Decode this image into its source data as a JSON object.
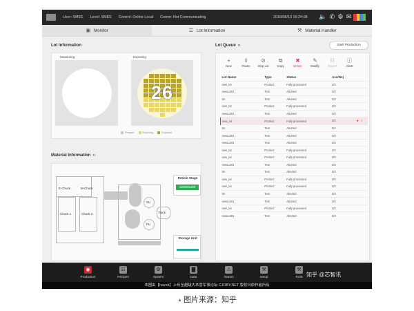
{
  "status_bar": {
    "user": "User: SMEE",
    "level": "Level: SMEE",
    "control": "Control: Online Local",
    "comm": "Comm: Not Communicating",
    "datetime": "2018/08/13 16:24:08",
    "icons": [
      "logo",
      "volume-icon",
      "phone-icon",
      "gear-icon",
      "mail-icon",
      "flag-icon"
    ]
  },
  "tabs": [
    {
      "label": "Monitor",
      "icon": "monitor-icon",
      "active": true
    },
    {
      "label": "Lot Information",
      "icon": "list-icon",
      "active": false
    },
    {
      "label": "Material Handler",
      "icon": "robot-arm-icon",
      "active": false
    }
  ],
  "lot_info": {
    "title": "Lot Information",
    "measuring_label": "Measuring",
    "exposing_label": "Exposing",
    "wafer_number": "26",
    "legend": [
      "Prepare",
      "Exposing",
      "Exposed"
    ],
    "colors": {
      "pending": "#c9c9c9",
      "exposing": "#e8d86a",
      "exposed": "#b9a52e",
      "wafer_bg": "#fbf6d8"
    }
  },
  "material_info": {
    "title": "Material Information",
    "e_chuck": "E-Chuck",
    "m_chuck": "M-Chuck",
    "chuck1": "Chuck 1",
    "chuck2": "Chuck 2",
    "reticle_stage_title": "Reticle Stage",
    "reticle_stage_value": "1105001300",
    "su_label": "SU",
    "track_label": "Track",
    "pu_label": "PU",
    "storage_unit_title": "Storage Unit"
  },
  "lot_queue": {
    "title": "Lot Queue",
    "start_button": "Start Production",
    "toolbar": [
      {
        "label": "New",
        "icon": "plus-icon",
        "state": "normal"
      },
      {
        "label": "Pause",
        "icon": "pause-icon",
        "state": "normal"
      },
      {
        "label": "Stop Lot",
        "icon": "stop-icon",
        "state": "normal"
      },
      {
        "label": "Copy",
        "icon": "copy-icon",
        "state": "normal"
      },
      {
        "label": "Delete",
        "icon": "trash-icon",
        "state": "danger"
      },
      {
        "label": "Modify",
        "icon": "edit-icon",
        "state": "normal"
      },
      {
        "label": "Report",
        "icon": "report-icon",
        "state": "disabled"
      },
      {
        "label": "Abort",
        "icon": "abort-icon",
        "state": "normal"
      }
    ],
    "columns": [
      "Lot Name",
      "Type",
      "Status",
      "Acc/Rej"
    ],
    "rows": [
      {
        "name": "new_lot",
        "type": "Product",
        "status": "Fully processed",
        "acc": "2/0"
      },
      {
        "name": "newLot01",
        "type": "Test",
        "status": "Aborted",
        "acc": "0/2"
      },
      {
        "name": "9A",
        "type": "Test",
        "status": "Aborted",
        "acc": "0/2"
      },
      {
        "name": "new_lot",
        "type": "Product",
        "status": "Fully processed",
        "acc": "2/0"
      },
      {
        "name": "newLot01",
        "type": "Test",
        "status": "Aborted",
        "acc": "0/2"
      },
      {
        "name": "new_lot",
        "type": "Product",
        "status": "Fully processed",
        "acc": "2/0",
        "selected": true
      },
      {
        "name": "9A",
        "type": "Test",
        "status": "Aborted",
        "acc": "0/2"
      },
      {
        "name": "newLot01",
        "type": "Test",
        "status": "Aborted",
        "acc": "0/2"
      },
      {
        "name": "newLot01",
        "type": "Test",
        "status": "Aborted",
        "acc": "0/2"
      },
      {
        "name": "new_lot",
        "type": "Product",
        "status": "Fully processed",
        "acc": "2/0"
      },
      {
        "name": "new_lot",
        "type": "Product",
        "status": "Fully processed",
        "acc": "2/0"
      },
      {
        "name": "newLot01",
        "type": "Test",
        "status": "Aborted",
        "acc": "0/2"
      },
      {
        "name": "9A",
        "type": "Test",
        "status": "Aborted",
        "acc": "0/2"
      },
      {
        "name": "new_lot",
        "type": "Product",
        "status": "Fully processed",
        "acc": "2/0"
      },
      {
        "name": "new_lot",
        "type": "Product",
        "status": "Fully processed",
        "acc": "2/0"
      },
      {
        "name": "9A",
        "type": "Test",
        "status": "Aborted",
        "acc": "0/2"
      },
      {
        "name": "newLot01",
        "type": "Test",
        "status": "Aborted",
        "acc": "0/2"
      },
      {
        "name": "new_lot",
        "type": "Product",
        "status": "Fully processed",
        "acc": "2/0"
      },
      {
        "name": "newLot01",
        "type": "Test",
        "status": "Aborted",
        "acc": "0/2"
      }
    ]
  },
  "bottom_nav": [
    {
      "label": "Production",
      "icon": "production-icon",
      "active": true
    },
    {
      "label": "Recipes",
      "icon": "recipes-icon",
      "active": false
    },
    {
      "label": "System",
      "icon": "gear-icon",
      "active": false
    },
    {
      "label": "Data",
      "icon": "bar-chart-icon",
      "active": false
    },
    {
      "label": "Alarms",
      "icon": "warning-icon",
      "active": false
    },
    {
      "label": "Setup",
      "icon": "setup-icon",
      "active": false
    },
    {
      "label": "Tools",
      "icon": "tools-icon",
      "active": false
    }
  ],
  "footer_text": "本图由【havok】上传至超级大本营军事论坛 CJDBY.NET 版权归原作者所有",
  "watermark": "知乎 @芯智讯",
  "caption": "图片来源：知乎"
}
